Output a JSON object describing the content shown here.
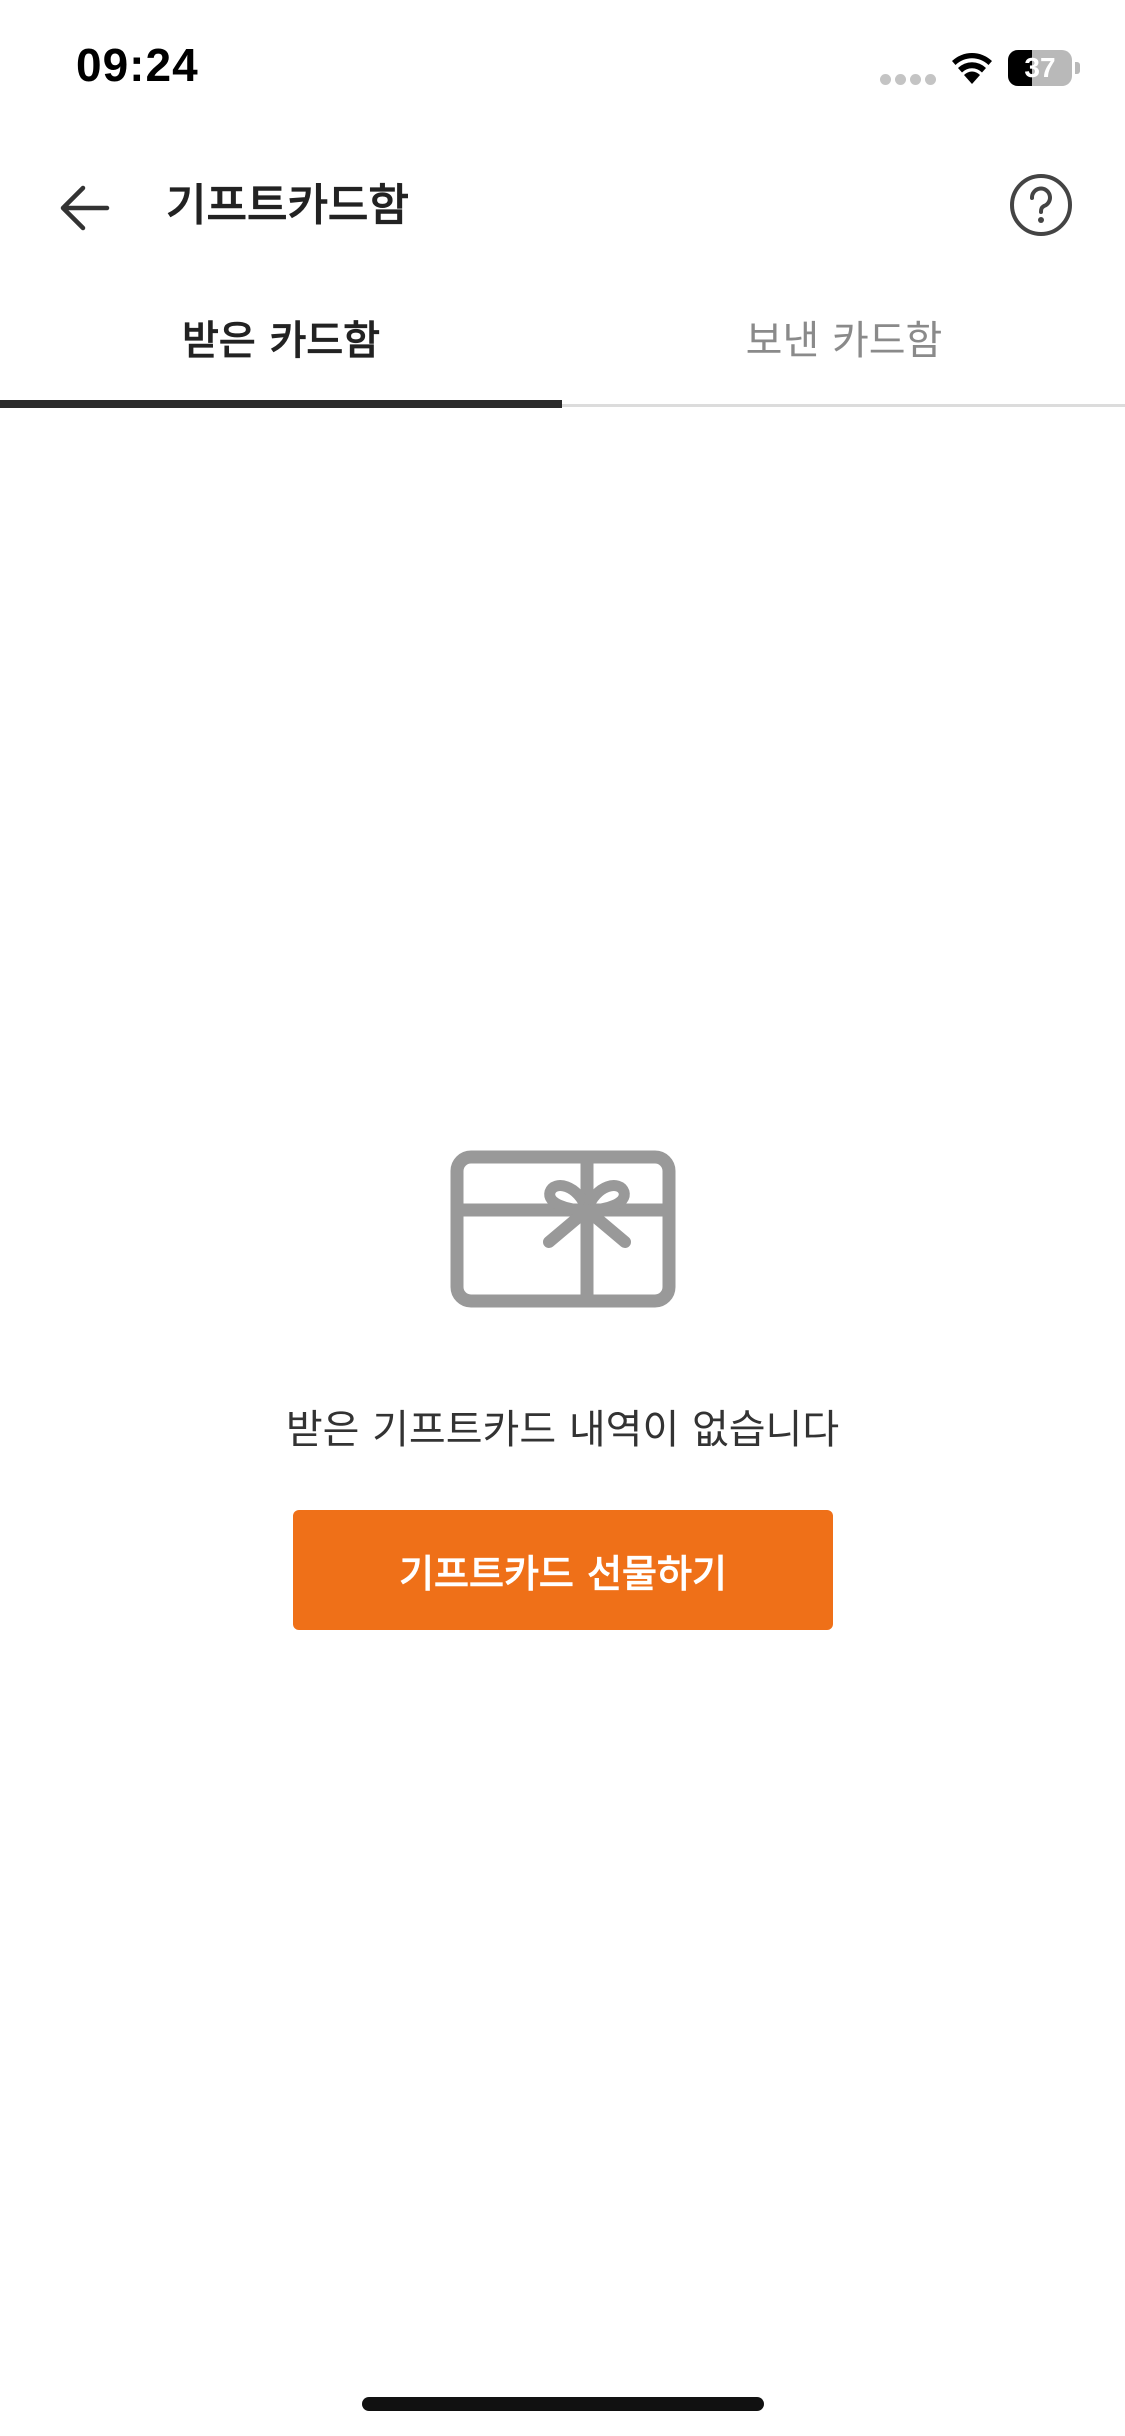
{
  "status_bar": {
    "time": "09:24",
    "battery_percent": "37",
    "battery_level": 0.37
  },
  "header": {
    "title": "기프트카드함",
    "back_icon": "arrow-left-icon",
    "help_icon": "question-circle-icon"
  },
  "tabs": [
    {
      "label": "받은 카드함",
      "active": true
    },
    {
      "label": "보낸 카드함",
      "active": false
    }
  ],
  "empty_state": {
    "icon": "gift-card-icon",
    "message": "받은 기프트카드 내역이 없습니다",
    "button_label": "기프트카드 선물하기"
  },
  "colors": {
    "accent": "#ef7018",
    "tab_indicator": "#2b2b2b",
    "inactive_tab_text": "#8a8a8a",
    "icon_gray": "#999999"
  }
}
